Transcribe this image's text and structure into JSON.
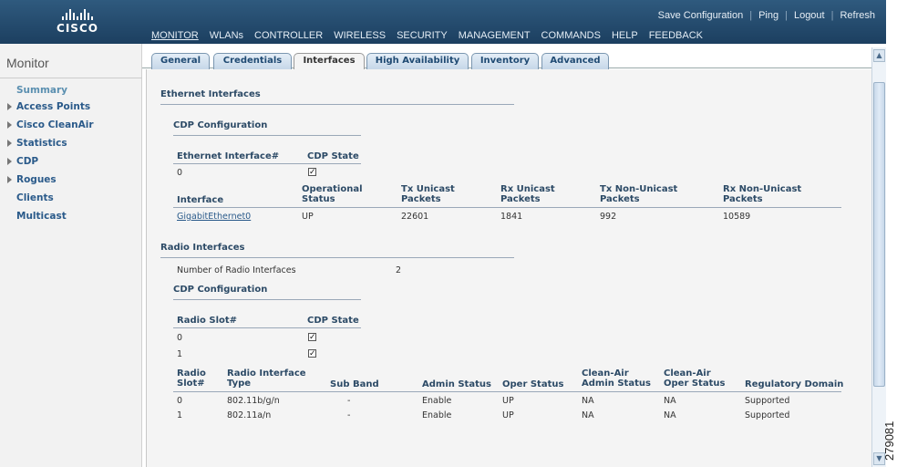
{
  "brand": {
    "name": "CISCO"
  },
  "top_links": [
    "Save Configuration",
    "Ping",
    "Logout",
    "Refresh"
  ],
  "main_nav": [
    "MONITOR",
    "WLANs",
    "CONTROLLER",
    "WIRELESS",
    "SECURITY",
    "MANAGEMENT",
    "COMMANDS",
    "HELP",
    "FEEDBACK"
  ],
  "main_nav_active": "MONITOR",
  "sidebar": {
    "title": "Monitor",
    "items": [
      {
        "label": "Summary",
        "arrow": false
      },
      {
        "label": "Access Points",
        "arrow": true
      },
      {
        "label": "Cisco CleanAir",
        "arrow": true
      },
      {
        "label": "Statistics",
        "arrow": true
      },
      {
        "label": "CDP",
        "arrow": true
      },
      {
        "label": "Rogues",
        "arrow": true
      },
      {
        "label": "Clients",
        "arrow": false
      },
      {
        "label": "Multicast",
        "arrow": false
      }
    ]
  },
  "tabs": [
    "General",
    "Credentials",
    "Interfaces",
    "High Availability",
    "Inventory",
    "Advanced"
  ],
  "active_tab": "Interfaces",
  "ethernet": {
    "title": "Ethernet Interfaces",
    "cdp_title": "CDP Configuration",
    "cdp_headers": [
      "Ethernet Interface#",
      "CDP State"
    ],
    "cdp_rows": [
      {
        "slot": "0",
        "checked": true
      }
    ],
    "if_headers": [
      "Interface",
      "Operational Status",
      "Tx Unicast Packets",
      "Rx Unicast Packets",
      "Tx Non-Unicast Packets",
      "Rx Non-Unicast Packets"
    ],
    "if_rows": [
      [
        "GigabitEthernet0",
        "UP",
        "22601",
        "1841",
        "992",
        "10589"
      ]
    ]
  },
  "radio": {
    "title": "Radio Interfaces",
    "count_label": "Number of Radio Interfaces",
    "count_value": "2",
    "cdp_title": "CDP Configuration",
    "cdp_headers": [
      "Radio Slot#",
      "CDP State"
    ],
    "cdp_rows": [
      {
        "slot": "0",
        "checked": true
      },
      {
        "slot": "1",
        "checked": true
      }
    ],
    "headers": [
      "Radio Slot#",
      "Radio Interface Type",
      "Sub Band",
      "Admin Status",
      "Oper Status",
      "Clean-Air Admin Status",
      "Clean-Air Oper Status",
      "Regulatory Domain"
    ],
    "rows": [
      [
        "0",
        "802.11b/g/n",
        "-",
        "Enable",
        "UP",
        "NA",
        "NA",
        "Supported"
      ],
      [
        "1",
        "802.11a/n",
        "-",
        "Enable",
        "UP",
        "NA",
        "NA",
        "Supported"
      ]
    ]
  },
  "figure_number": "279081"
}
